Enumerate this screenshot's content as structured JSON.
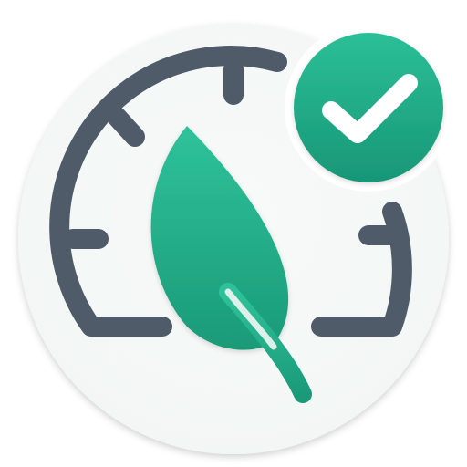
{
  "app_icon": {
    "background_color": "#f2f6f4",
    "gauge_color": "#4f5b68",
    "leaf_color_top": "#2fc29a",
    "leaf_color_bottom": "#1a9a78",
    "badge_color_top": "#2bbf97",
    "badge_color_bottom": "#189777",
    "check_color": "#ffffff",
    "icons": [
      "speedometer-icon",
      "leaf-icon",
      "checkmark-badge-icon"
    ]
  }
}
